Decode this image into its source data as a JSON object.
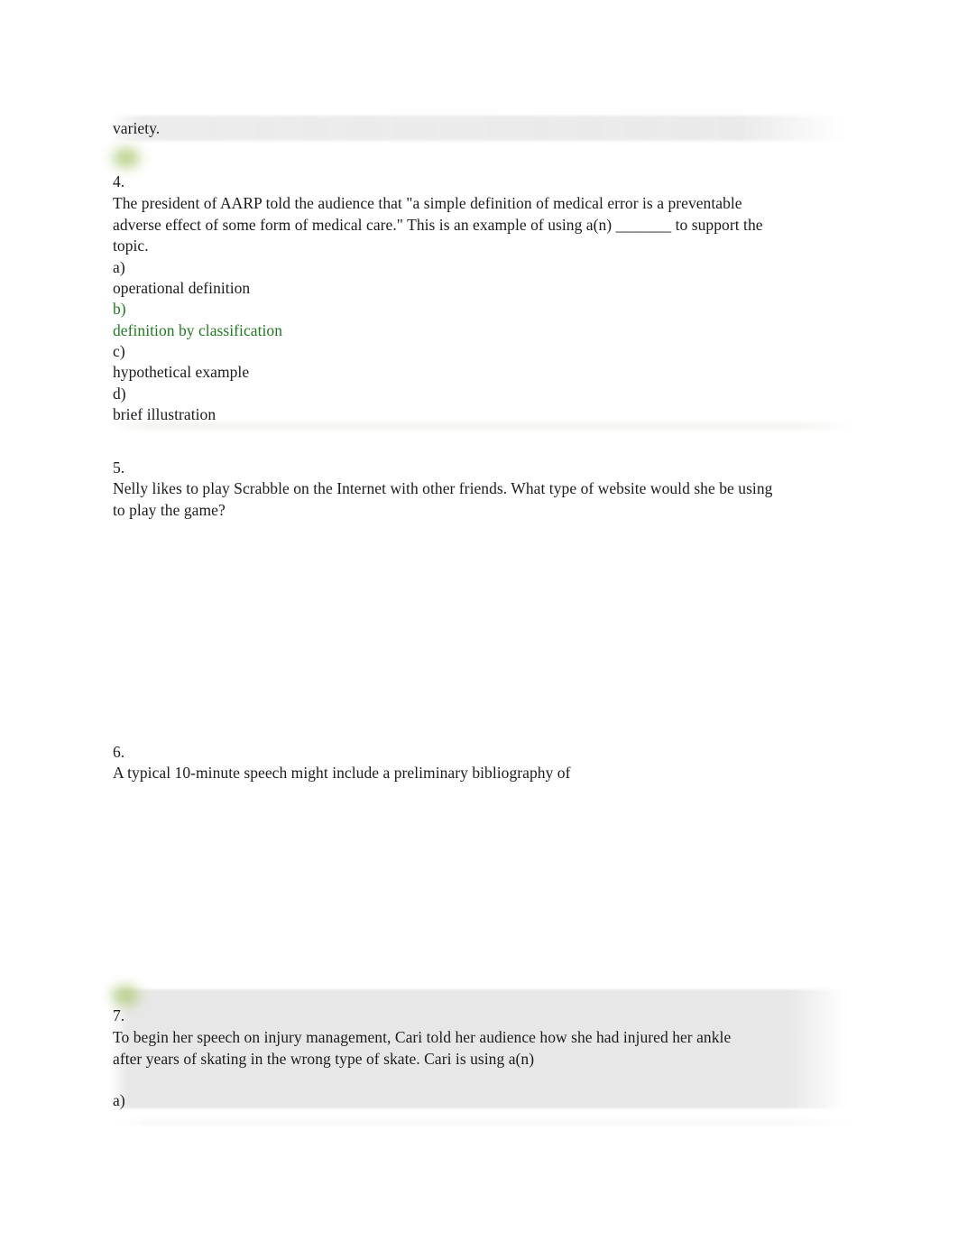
{
  "document": {
    "continuation_text": "variety.",
    "questions": [
      {
        "number": "4.",
        "body": "The president of AARP told the audience that \"a simple definition of medical error is a preventable adverse effect of some form of medical care.\" This is an example of using a(n) _______ to support the topic.",
        "options": [
          {
            "letter": "a)",
            "text": "operational definition",
            "highlighted": false
          },
          {
            "letter": "b)",
            "text": "definition by classification",
            "highlighted": true
          },
          {
            "letter": "c)",
            "text": "hypothetical example",
            "highlighted": false
          },
          {
            "letter": "d)",
            "text": "brief illustration",
            "highlighted": false
          }
        ]
      },
      {
        "number": "5.",
        "body": "Nelly likes to play  Scrabble  on the Internet with other friends. What type of website would she be using to play the game?",
        "options": []
      },
      {
        "number": "6.",
        "body": "A typical 10-minute speech might include a preliminary bibliography of",
        "options": []
      },
      {
        "number": "7.",
        "body": "To begin her speech on injury management, Cari told her audience how she had injured her ankle after years of skating in the wrong type of skate. Cari is using a(n)",
        "options": [
          {
            "letter": "a)",
            "text": "",
            "highlighted": false
          }
        ]
      }
    ]
  },
  "colors": {
    "highlight_green": "#1f7a21",
    "body_text": "#1c1c1c",
    "shade_band": "#e7e7e7",
    "marker_blob": "#b8cf86"
  }
}
